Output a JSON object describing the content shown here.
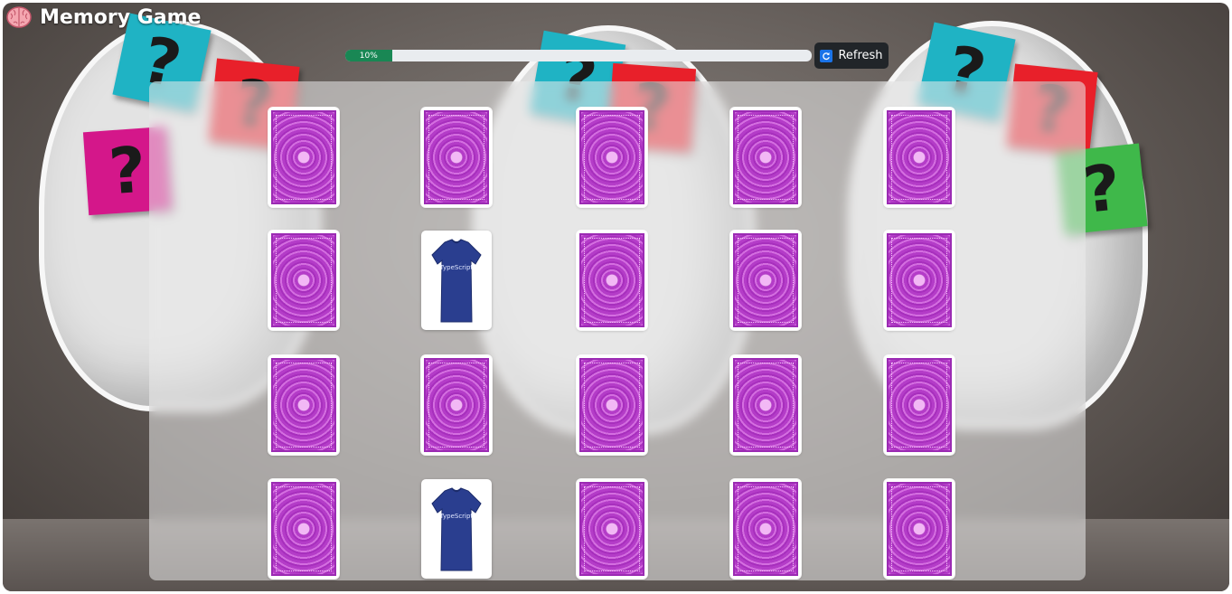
{
  "app": {
    "title": "Memory Game",
    "icon": "brain-icon"
  },
  "progress": {
    "value": 0.1,
    "label": "10%",
    "color": "#198754"
  },
  "toolbar": {
    "refresh_label": "Refresh",
    "refresh_icon": "refresh-icon"
  },
  "board": {
    "rows": 4,
    "columns": 5,
    "cards": [
      {
        "state": "face-down"
      },
      {
        "state": "face-down"
      },
      {
        "state": "face-down"
      },
      {
        "state": "face-down"
      },
      {
        "state": "face-down"
      },
      {
        "state": "face-down"
      },
      {
        "state": "face-up",
        "image": "tshirt",
        "brand": "TypeScript"
      },
      {
        "state": "face-down"
      },
      {
        "state": "face-down"
      },
      {
        "state": "face-down"
      },
      {
        "state": "face-down"
      },
      {
        "state": "face-down"
      },
      {
        "state": "face-down"
      },
      {
        "state": "face-down"
      },
      {
        "state": "face-down"
      },
      {
        "state": "face-down"
      },
      {
        "state": "face-up",
        "image": "tshirt",
        "brand": "TypeScript"
      },
      {
        "state": "face-down"
      },
      {
        "state": "face-down"
      },
      {
        "state": "face-down"
      }
    ],
    "card_back_color": "#b940cc"
  }
}
